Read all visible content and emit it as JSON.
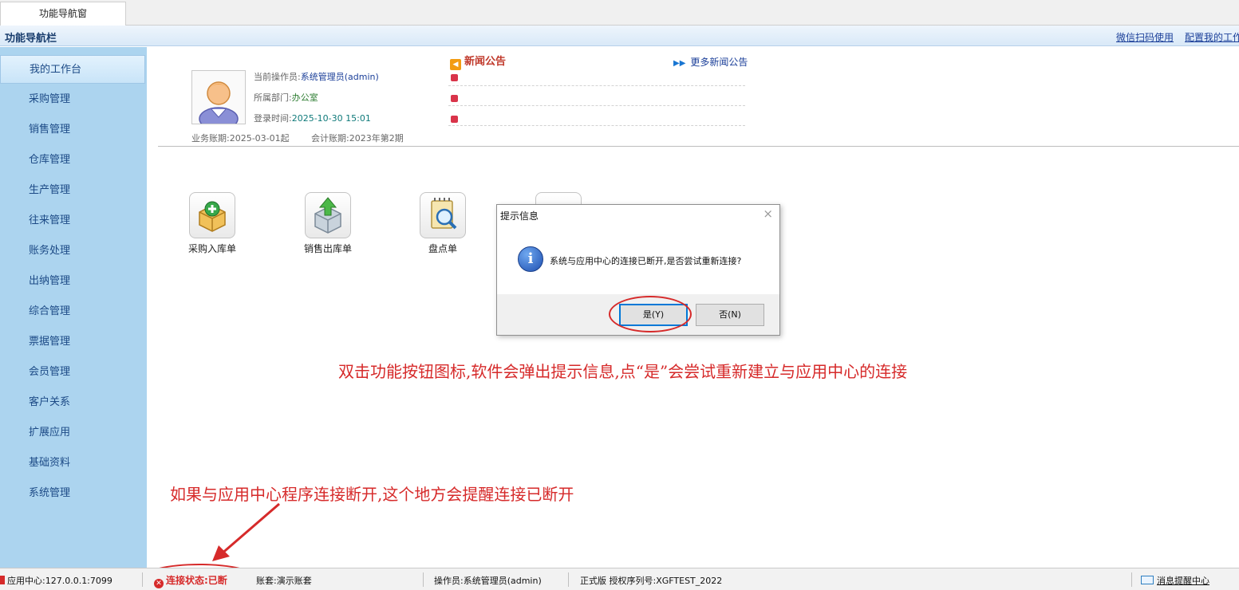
{
  "tab": {
    "label": "功能导航窗"
  },
  "navbar": {
    "title": "功能导航栏",
    "link_wechat": "微信扫码使用",
    "link_config": "配置我的工作"
  },
  "sidebar": {
    "items": [
      {
        "label": "我的工作台",
        "active": true
      },
      {
        "label": "采购管理"
      },
      {
        "label": "销售管理"
      },
      {
        "label": "仓库管理"
      },
      {
        "label": "生产管理"
      },
      {
        "label": "往来管理"
      },
      {
        "label": "账务处理"
      },
      {
        "label": "出纳管理"
      },
      {
        "label": "综合管理"
      },
      {
        "label": "票据管理"
      },
      {
        "label": "会员管理"
      },
      {
        "label": "客户关系"
      },
      {
        "label": "扩展应用"
      },
      {
        "label": "基础资料"
      },
      {
        "label": "系统管理"
      }
    ]
  },
  "user": {
    "operator_label": "当前操作员:",
    "operator_value": "系统管理员(admin)",
    "dept_label": "所属部门:",
    "dept_value": "办公室",
    "login_label": "登录时间:",
    "login_value": "2025-10-30 15:01",
    "business_period": "业务账期:2025-03-01起",
    "accounting_period": "会计账期:2023年第2期"
  },
  "news": {
    "title": "新闻公告",
    "more": "更多新闻公告"
  },
  "shortcuts": [
    {
      "label": "采购入库单"
    },
    {
      "label": "销售出库单"
    },
    {
      "label": "盘点单"
    }
  ],
  "dialog": {
    "title": "提示信息",
    "message": "系统与应用中心的连接已断开,是否尝试重新连接?",
    "yes": "是(Y)",
    "no": "否(N)"
  },
  "annotations": {
    "dialog_note": "双击功能按钮图标,软件会弹出提示信息,点“是”会尝试重新建立与应用中心的连接",
    "status_note": "如果与应用中心程序连接断开,这个地方会提醒连接已断开"
  },
  "status": {
    "app_center": "应用中心:127.0.0.1:7099",
    "connection": "连接状态:已断",
    "account_set": "账套:演示账套",
    "operator": "操作员:系统管理员(admin)",
    "edition": "正式版 授权序列号:XGFTEST_2022",
    "messages": "消息提醒中心"
  },
  "colors": {
    "sidebar_bg": "#acd4ef",
    "annotation": "#d62a2a",
    "link": "#1b3f99"
  }
}
